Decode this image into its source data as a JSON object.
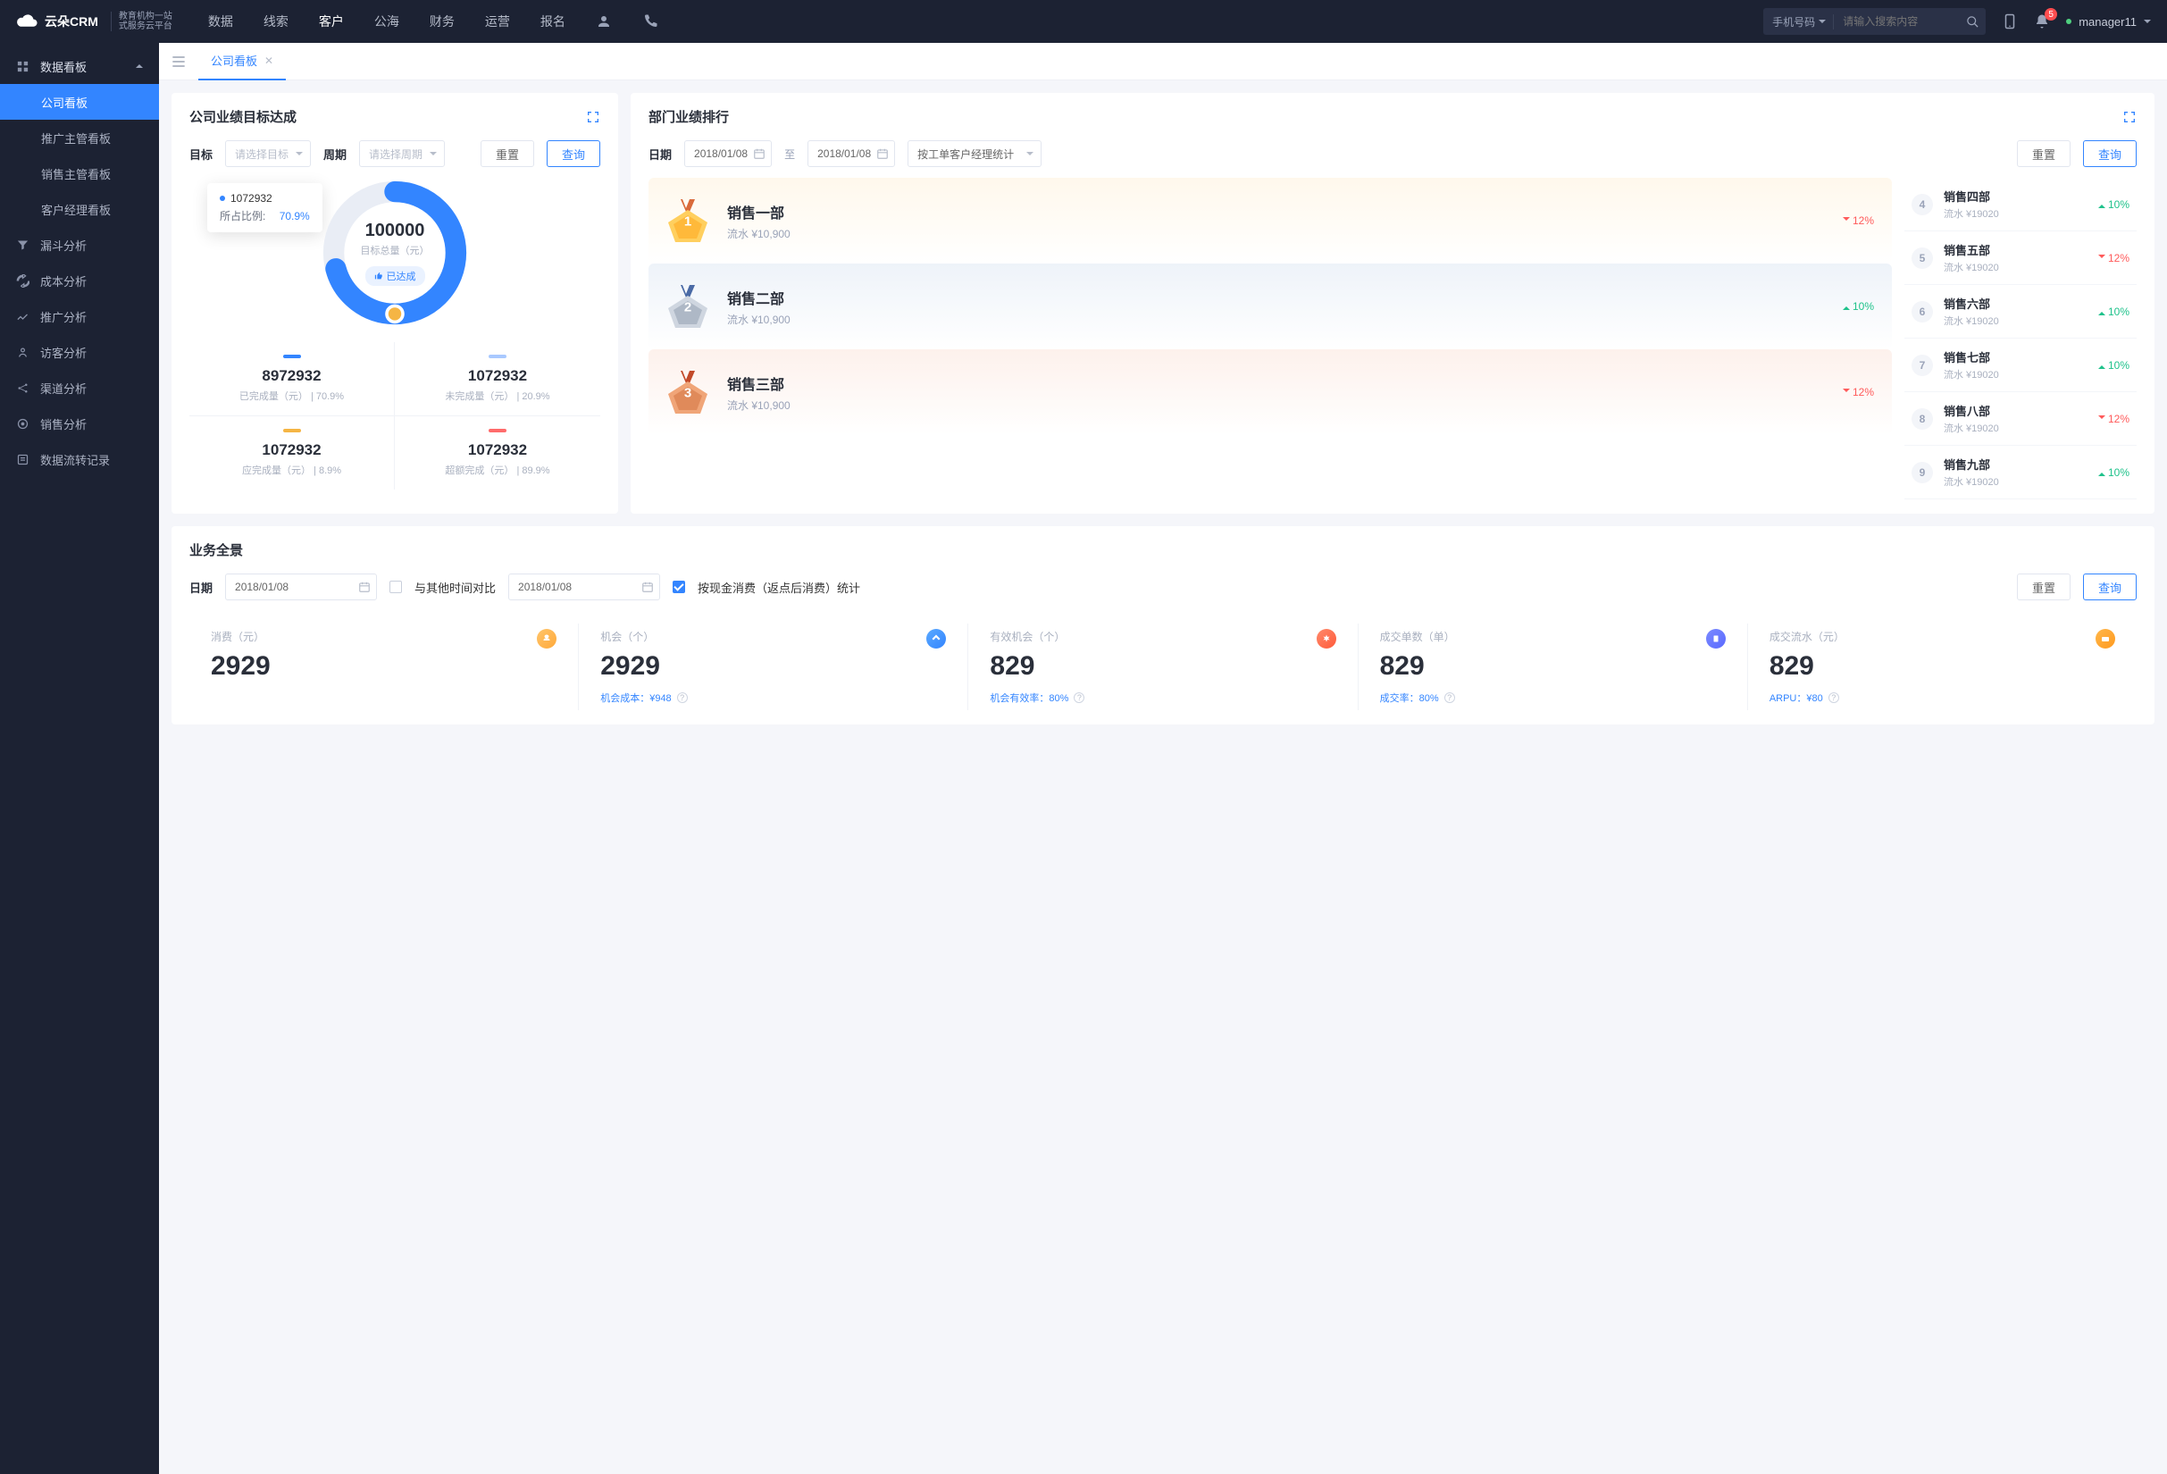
{
  "brand": {
    "name": "云朵CRM",
    "sub1": "教育机构一站",
    "sub2": "式服务云平台"
  },
  "topnav": [
    "数据",
    "线索",
    "客户",
    "公海",
    "财务",
    "运营",
    "报名"
  ],
  "topnav_active": 2,
  "search": {
    "type": "手机号码",
    "placeholder": "请输入搜索内容"
  },
  "notif_count": "5",
  "username": "manager11",
  "sidebar": {
    "parent": "数据看板",
    "children": [
      "公司看板",
      "推广主管看板",
      "销售主管看板",
      "客户经理看板"
    ],
    "active_child": 0,
    "items": [
      "漏斗分析",
      "成本分析",
      "推广分析",
      "访客分析",
      "渠道分析",
      "销售分析",
      "数据流转记录"
    ]
  },
  "tab": {
    "label": "公司看板"
  },
  "goal": {
    "title": "公司业绩目标达成",
    "target_label": "目标",
    "target_ph": "请选择目标",
    "period_label": "周期",
    "period_ph": "请选择周期",
    "reset": "重置",
    "query": "查询",
    "center_num": "100000",
    "center_lab": "目标总量（元）",
    "center_badge": "已达成",
    "tooltip": {
      "value": "1072932",
      "ratio_lab": "所占比例:",
      "ratio": "70.9%"
    },
    "stats": [
      {
        "num": "8972932",
        "lab": "已完成量（元）",
        "pct": "70.9%"
      },
      {
        "num": "1072932",
        "lab": "未完成量（元）",
        "pct": "20.9%"
      },
      {
        "num": "1072932",
        "lab": "应完成量（元）",
        "pct": "8.9%"
      },
      {
        "num": "1072932",
        "lab": "超额完成（元）",
        "pct": "89.9%"
      }
    ]
  },
  "rank": {
    "title": "部门业绩排行",
    "date_label": "日期",
    "date_from": "2018/01/08",
    "to": "至",
    "date_to": "2018/01/08",
    "mode": "按工单客户经理统计",
    "reset": "重置",
    "query": "查询",
    "top3": [
      {
        "name": "销售一部",
        "sub": "流水 ¥10,900",
        "delta": "12%",
        "dir": "down"
      },
      {
        "name": "销售二部",
        "sub": "流水 ¥10,900",
        "delta": "10%",
        "dir": "up"
      },
      {
        "name": "销售三部",
        "sub": "流水 ¥10,900",
        "delta": "12%",
        "dir": "down"
      }
    ],
    "rest": [
      {
        "n": "4",
        "name": "销售四部",
        "sub": "流水 ¥19020",
        "delta": "10%",
        "dir": "up"
      },
      {
        "n": "5",
        "name": "销售五部",
        "sub": "流水 ¥19020",
        "delta": "12%",
        "dir": "down"
      },
      {
        "n": "6",
        "name": "销售六部",
        "sub": "流水 ¥19020",
        "delta": "10%",
        "dir": "up"
      },
      {
        "n": "7",
        "name": "销售七部",
        "sub": "流水 ¥19020",
        "delta": "10%",
        "dir": "up"
      },
      {
        "n": "8",
        "name": "销售八部",
        "sub": "流水 ¥19020",
        "delta": "12%",
        "dir": "down"
      },
      {
        "n": "9",
        "name": "销售九部",
        "sub": "流水 ¥19020",
        "delta": "10%",
        "dir": "up"
      }
    ]
  },
  "pano": {
    "title": "业务全景",
    "date_label": "日期",
    "date": "2018/01/08",
    "compare": "与其他时间对比",
    "date2": "2018/01/08",
    "check_label": "按现金消费（返点后消费）统计",
    "reset": "重置",
    "query": "查询",
    "cells": [
      {
        "lab": "消费（元）",
        "num": "2929",
        "sub": "",
        "subv": ""
      },
      {
        "lab": "机会（个）",
        "num": "2929",
        "sub": "机会成本：",
        "subv": "¥948"
      },
      {
        "lab": "有效机会（个）",
        "num": "829",
        "sub": "机会有效率：",
        "subv": "80%"
      },
      {
        "lab": "成交单数（单）",
        "num": "829",
        "sub": "成交率：",
        "subv": "80%"
      },
      {
        "lab": "成交流水（元）",
        "num": "829",
        "sub": "ARPU：",
        "subv": "¥80"
      }
    ]
  },
  "chart_data": {
    "type": "pie",
    "title": "目标总量（元）",
    "total": 100000,
    "series": [
      {
        "name": "已完成量（元）",
        "value": 8972932,
        "pct": 70.9,
        "color": "#3385ff"
      },
      {
        "name": "未完成量（元）",
        "value": 1072932,
        "pct": 20.9,
        "color": "#a9c9ff"
      },
      {
        "name": "应完成量（元）",
        "value": 1072932,
        "pct": 8.9,
        "color": "#f5b544"
      },
      {
        "name": "超额完成（元）",
        "value": 1072932,
        "pct": 89.9,
        "color": "#ff6b6b"
      }
    ],
    "highlight": {
      "value": 1072932,
      "pct": 70.9
    }
  }
}
